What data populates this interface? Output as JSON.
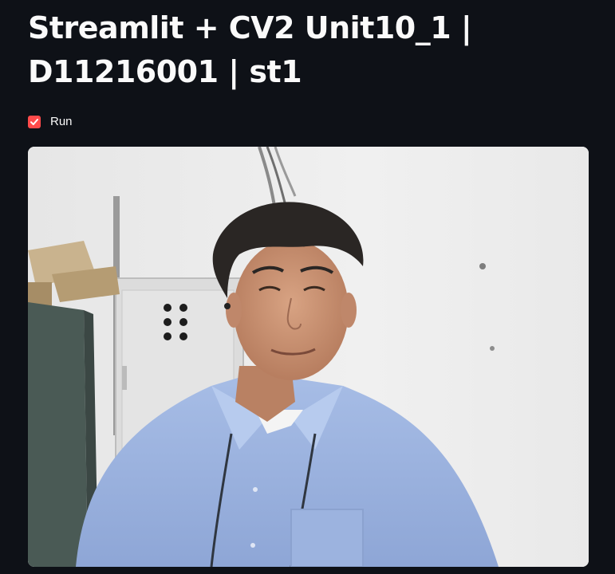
{
  "page": {
    "title": "Streamlit + CV2 Unit10_1 | D11216001 | st1"
  },
  "controls": {
    "run_checkbox": {
      "label": "Run",
      "checked": true
    }
  },
  "camera_frame": {
    "description": "webcam video frame"
  },
  "colors": {
    "background": "#0e1117",
    "text": "#fafafa",
    "accent": "#ff4b4b"
  },
  "icons": {
    "checkbox": "checkmark-icon"
  }
}
